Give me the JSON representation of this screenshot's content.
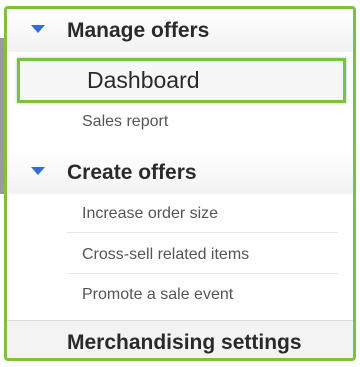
{
  "nav": {
    "manage_offers": {
      "label": "Manage offers",
      "expanded": true,
      "items": [
        {
          "label": "Dashboard",
          "selected": true
        },
        {
          "label": "Sales report",
          "selected": false
        }
      ]
    },
    "create_offers": {
      "label": "Create offers",
      "expanded": true,
      "items": [
        {
          "label": "Increase order size"
        },
        {
          "label": "Cross-sell related items"
        },
        {
          "label": "Promote a sale event"
        }
      ]
    },
    "merchandising_settings": {
      "label": "Merchandising settings"
    }
  },
  "colors": {
    "accent": "#7cc23e",
    "triangle": "#2f6fd1"
  },
  "icons": {
    "expand": "triangle-down-icon"
  }
}
